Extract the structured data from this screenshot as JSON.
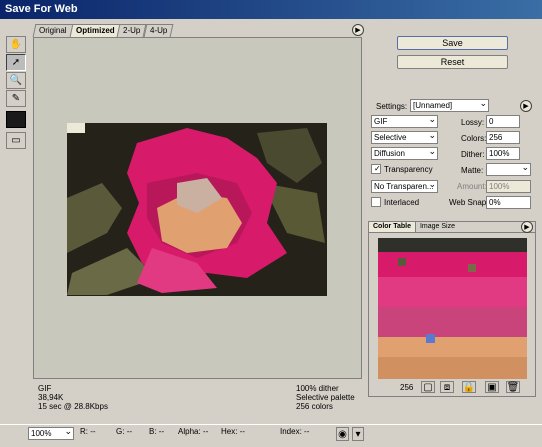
{
  "window": {
    "title": "Save For Web"
  },
  "tabs": [
    "Original",
    "Optimized",
    "2-Up",
    "4-Up"
  ],
  "active_tab": 1,
  "info": {
    "left": [
      "GIF",
      "38,94K",
      "15 sec @ 28.8Kbps"
    ],
    "right": [
      "100% dither",
      "Selective palette",
      "256 colors"
    ]
  },
  "buttons": {
    "save": "Save",
    "reset": "Reset"
  },
  "settings": {
    "label": "Settings:",
    "preset": "[Unnamed]",
    "format": "GIF",
    "reduction": "Selective",
    "dither_algo": "Diffusion",
    "transparency_label": "Transparency",
    "transparency_checked": true,
    "no_transparency": "No Transparen...",
    "interlaced_label": "Interlaced",
    "interlaced_checked": false,
    "lossy_label": "Lossy:",
    "lossy_value": "0",
    "colors_label": "Colors:",
    "colors_value": "256",
    "dither_label": "Dither:",
    "dither_value": "100%",
    "matte_label": "Matte:",
    "amount_label": "Amount:",
    "amount_value": "100%",
    "websnap_label": "Web Snap:",
    "websnap_value": "0%"
  },
  "panel_tabs": [
    "Color Table",
    "Image Size"
  ],
  "color_count": "256",
  "status": {
    "zoom": "100%",
    "r_label": "R:",
    "r_value": "--",
    "g_label": "G:",
    "g_value": "--",
    "b_label": "B:",
    "b_value": "--",
    "alpha_label": "Alpha:",
    "alpha_value": "--",
    "hex_label": "Hex:",
    "hex_value": "--",
    "index_label": "Index:",
    "index_value": "--"
  },
  "colors": {
    "titlebar": "#0a246a",
    "magenta": "#d81a6a",
    "peach": "#e0a070",
    "olive": "#5a5a3a"
  }
}
